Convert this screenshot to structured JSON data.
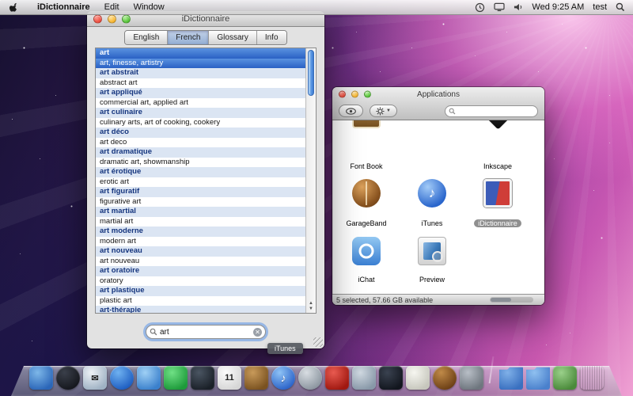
{
  "menu_bar": {
    "menus": [
      "iDictionnaire",
      "Edit",
      "Window"
    ],
    "clock": "Wed 9:25 AM",
    "user": "test"
  },
  "dictionary_window": {
    "title": "iDictionnaire",
    "tabs": [
      {
        "label": "English",
        "active": false
      },
      {
        "label": "French",
        "active": true
      },
      {
        "label": "Glossary",
        "active": false
      },
      {
        "label": "Info",
        "active": false
      }
    ],
    "entries": [
      {
        "term": "art",
        "translation": "art, finesse, artistry",
        "selected": true
      },
      {
        "term": "art abstrait",
        "translation": "abstract art"
      },
      {
        "term": "art appliqué",
        "translation": "commercial art, applied art"
      },
      {
        "term": "art culinaire",
        "translation": "culinary arts, art of cooking, cookery"
      },
      {
        "term": "art déco",
        "translation": "art deco"
      },
      {
        "term": "art dramatique",
        "translation": "dramatic art, showmanship"
      },
      {
        "term": "art érotique",
        "translation": "erotic art"
      },
      {
        "term": "art figuratif",
        "translation": "figurative art"
      },
      {
        "term": "art martial",
        "translation": "martial art"
      },
      {
        "term": "art moderne",
        "translation": "modern art"
      },
      {
        "term": "art nouveau",
        "translation": "art nouveau"
      },
      {
        "term": "art oratoire",
        "translation": "oratory"
      },
      {
        "term": "art plastique",
        "translation": "plastic art"
      },
      {
        "term": "art-thérapie",
        "translation": null
      }
    ],
    "search": {
      "value": "art"
    }
  },
  "finder_window": {
    "title": "Applications",
    "status": "5 selected, 57.66 GB available",
    "search_value": "",
    "icons": [
      {
        "label": "Font Book",
        "kind": "fontbook",
        "row": 0,
        "col": 0,
        "selected": false
      },
      {
        "label": "Inkscape",
        "kind": "inkscape",
        "row": 0,
        "col": 2,
        "selected": false
      },
      {
        "label": "GarageBand",
        "kind": "garageband",
        "row": 1,
        "col": 0,
        "selected": false
      },
      {
        "label": "iTunes",
        "kind": "itunes",
        "row": 1,
        "col": 1,
        "selected": false
      },
      {
        "label": "iDictionnaire",
        "kind": "idictionnaire",
        "row": 1,
        "col": 2,
        "selected": true
      },
      {
        "label": "iChat",
        "kind": "ichat",
        "row": 2,
        "col": 0,
        "selected": false
      },
      {
        "label": "Preview",
        "kind": "preview",
        "row": 2,
        "col": 1,
        "selected": false
      },
      {
        "label": "",
        "kind": "camera",
        "row": 3,
        "col": 0,
        "selected": false
      }
    ]
  },
  "tooltip": {
    "text": "iTunes"
  },
  "dock": {
    "items": [
      {
        "name": "finder",
        "c1": "#7db7e8",
        "c2": "#2b66b8"
      },
      {
        "name": "dashboard",
        "c1": "#3a3f4a",
        "c2": "#14161c",
        "shape": "circle"
      },
      {
        "name": "mail",
        "c1": "#eef2f6",
        "c2": "#9fb2c4",
        "glyph": "✉",
        "dark": true
      },
      {
        "name": "safari",
        "c1": "#6fb1f0",
        "c2": "#1c5cc0",
        "shape": "circle"
      },
      {
        "name": "ichat",
        "c1": "#9fd0f5",
        "c2": "#3a80cc"
      },
      {
        "name": "facetime",
        "c1": "#6fe085",
        "c2": "#1d9a3a"
      },
      {
        "name": "photo-booth",
        "c1": "#4a5562",
        "c2": "#1a2028"
      },
      {
        "name": "ical",
        "c1": "#fbfbfb",
        "c2": "#d6d6d6",
        "glyph": "11",
        "dark": true
      },
      {
        "name": "address-book",
        "c1": "#c89a5a",
        "c2": "#7a5220"
      },
      {
        "name": "itunes",
        "c1": "#8ec2f5",
        "c2": "#2a62c8",
        "shape": "circle",
        "glyph": "♪"
      },
      {
        "name": "dvd-player",
        "c1": "#d8dde2",
        "c2": "#8a949e",
        "shape": "circle"
      },
      {
        "name": "app-red",
        "c1": "#e85a50",
        "c2": "#a01810"
      },
      {
        "name": "preview",
        "c1": "#cfd8e0",
        "c2": "#8898a8"
      },
      {
        "name": "photos-app",
        "c1": "#3a4250",
        "c2": "#12161e"
      },
      {
        "name": "design-app",
        "c1": "#f6f6f0",
        "c2": "#c6c6bc"
      },
      {
        "name": "garageband",
        "c1": "#c08a48",
        "c2": "#6b3e14",
        "shape": "circle"
      },
      {
        "name": "system-preferences",
        "c1": "#b8bec6",
        "c2": "#6e767e"
      },
      {
        "divider": true
      },
      {
        "name": "applications-folder",
        "c1": "#7fb0e8",
        "c2": "#3a70c0",
        "shape": "folder"
      },
      {
        "name": "documents-folder",
        "c1": "#8fc0f0",
        "c2": "#4a80cc",
        "shape": "folder"
      },
      {
        "name": "downloads-stack",
        "c1": "#9ad08a",
        "c2": "#4a8a3a"
      },
      {
        "name": "trash",
        "c1": "#e4e8ec",
        "c2": "#9aa2aa",
        "mesh": true
      }
    ]
  }
}
